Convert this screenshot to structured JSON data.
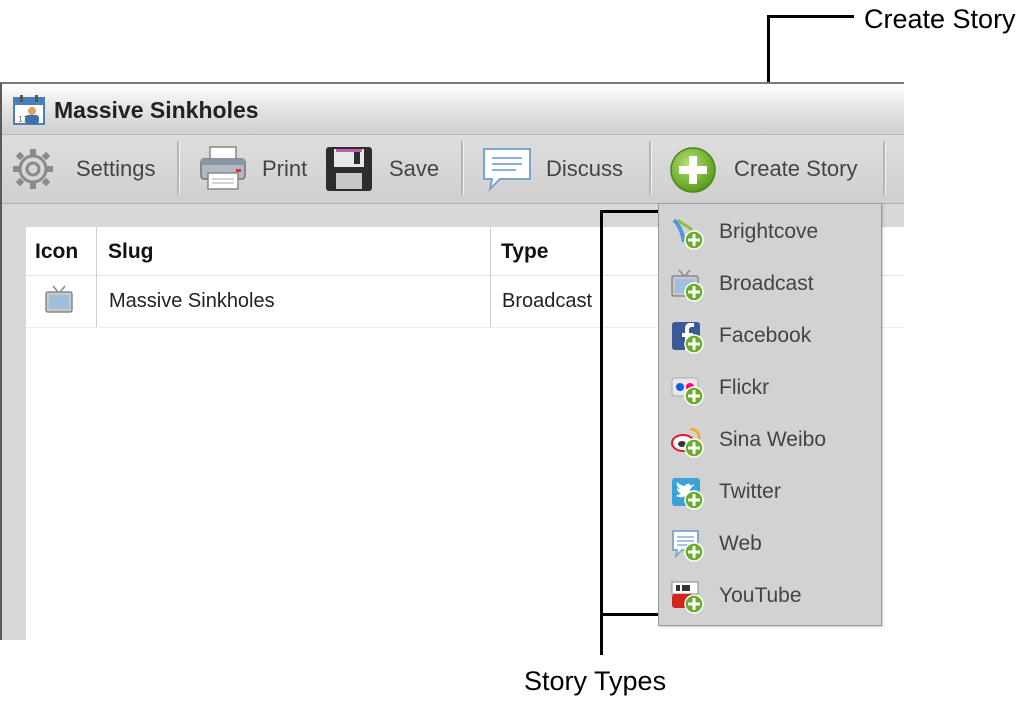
{
  "annotations": {
    "create_story": "Create Story",
    "story_types": "Story Types"
  },
  "window": {
    "title": "Massive Sinkholes",
    "icon": "calendar-person-icon"
  },
  "toolbar": {
    "settings": "Settings",
    "print": "Print",
    "save": "Save",
    "discuss": "Discuss",
    "create_story": "Create Story"
  },
  "table": {
    "columns": [
      "Icon",
      "Slug",
      "Type"
    ],
    "rows": [
      {
        "icon": "broadcast-tv-icon",
        "slug": "Massive Sinkholes",
        "type": "Broadcast"
      }
    ]
  },
  "story_types": [
    {
      "label": "Brightcove",
      "icon": "brightcove-add-icon"
    },
    {
      "label": "Broadcast",
      "icon": "broadcast-add-icon"
    },
    {
      "label": "Facebook",
      "icon": "facebook-add-icon"
    },
    {
      "label": "Flickr",
      "icon": "flickr-add-icon"
    },
    {
      "label": "Sina Weibo",
      "icon": "sina-weibo-add-icon"
    },
    {
      "label": "Twitter",
      "icon": "twitter-add-icon"
    },
    {
      "label": "Web",
      "icon": "web-add-icon"
    },
    {
      "label": "YouTube",
      "icon": "youtube-add-icon"
    }
  ],
  "colors": {
    "add_green": "#6aac2a",
    "facebook_blue": "#3b5998",
    "twitter_blue": "#3aa2d8",
    "youtube_red": "#d0261d"
  }
}
